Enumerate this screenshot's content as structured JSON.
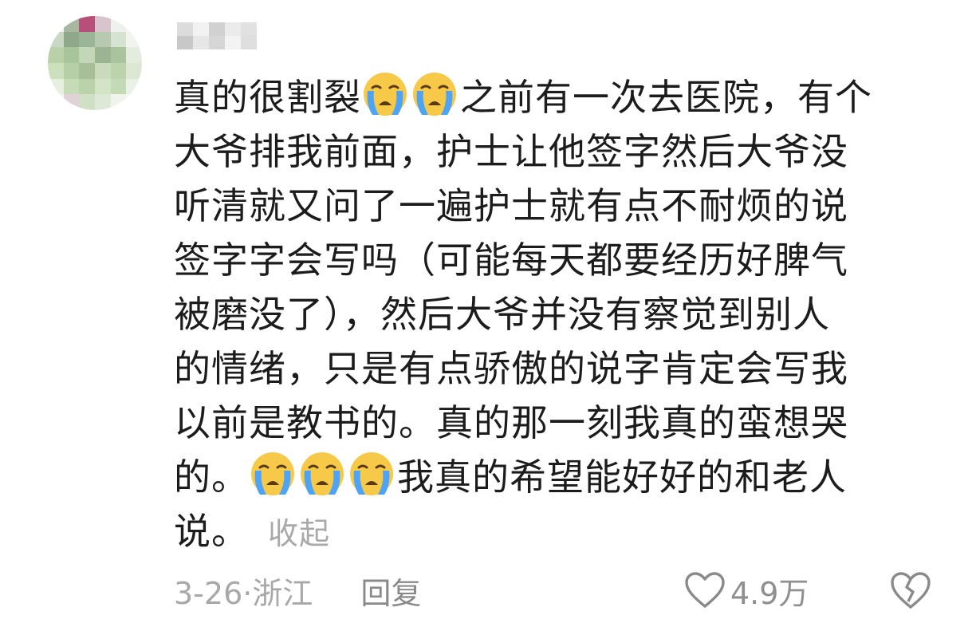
{
  "comment": {
    "lines": [
      "真的很割裂",
      "之前有一次去医院，有个",
      "大爷排我前面，护士让他签字然后大爷没",
      "听清就又问了一遍护士就有点不耐烦的说",
      "签字字会写吗（可能每天都要经历好脾气",
      "被磨没了），然后大爷并没有察觉到别人",
      "的情绪，只是有点骄傲的说字肯定会写我",
      "以前是教书的。真的那一刻我真的蛮想哭",
      "的。",
      "我真的希望能好好的和老人",
      "说。"
    ],
    "collapse_label": "收起",
    "emoji_name": "loudly-crying-face-icon"
  },
  "footer": {
    "date_location": "3-26·浙江",
    "reply_label": "回复",
    "like_count": "4.9万"
  },
  "colors": {
    "text": "#1c1c1c",
    "muted": "#a3a3a3",
    "emoji_face": "#f7c948",
    "emoji_tear": "#4da3f5"
  }
}
